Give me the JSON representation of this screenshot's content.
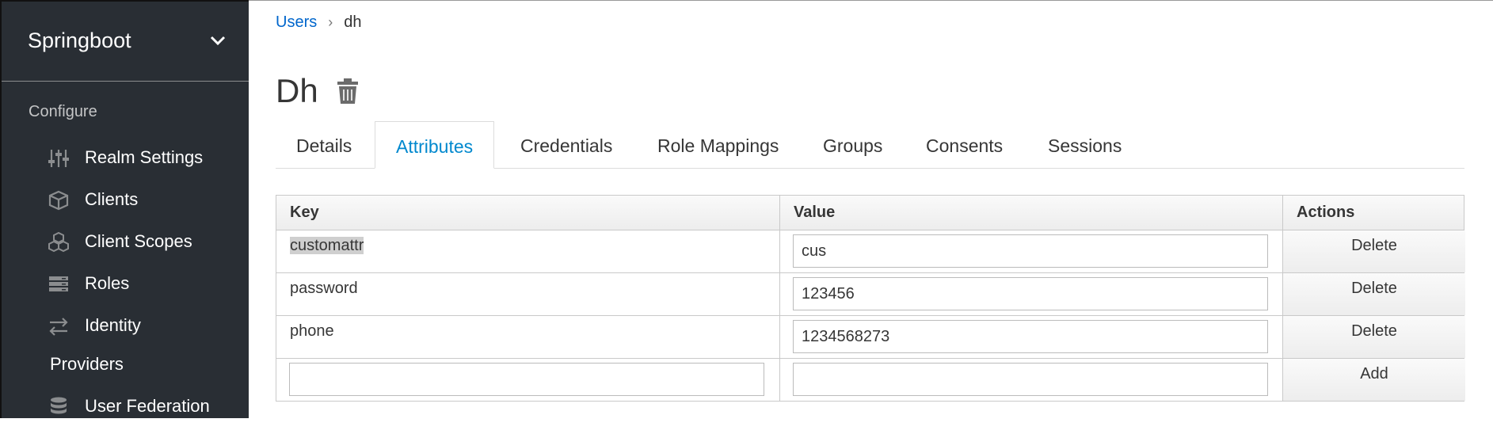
{
  "sidebar": {
    "realm_name": "Springboot",
    "section_label": "Configure",
    "items": [
      {
        "label": "Realm Settings",
        "icon": "sliders-icon"
      },
      {
        "label": "Clients",
        "icon": "cube-icon"
      },
      {
        "label": "Client Scopes",
        "icon": "cubes-icon"
      },
      {
        "label": "Roles",
        "icon": "server-icon"
      },
      {
        "label": "Identity",
        "label_cont": "Providers",
        "icon": "exchange-icon"
      },
      {
        "label": "User Federation",
        "icon": "database-icon"
      }
    ]
  },
  "breadcrumb": {
    "users": "Users",
    "separator": "›",
    "current": "dh"
  },
  "page_title": "Dh",
  "tabs": [
    {
      "label": "Details"
    },
    {
      "label": "Attributes",
      "active": true
    },
    {
      "label": "Credentials"
    },
    {
      "label": "Role Mappings"
    },
    {
      "label": "Groups"
    },
    {
      "label": "Consents"
    },
    {
      "label": "Sessions"
    }
  ],
  "table": {
    "headers": {
      "key": "Key",
      "value": "Value",
      "actions": "Actions"
    },
    "rows": [
      {
        "key": "customattr",
        "value": "cus",
        "action": "Delete"
      },
      {
        "key": "password",
        "value": "123456",
        "action": "Delete"
      },
      {
        "key": "phone",
        "value": "1234568273",
        "action": "Delete"
      }
    ],
    "new_row": {
      "key": "",
      "value": "",
      "action": "Add"
    }
  },
  "colors": {
    "sidebar_bg": "#292e34",
    "link": "#0066cc",
    "active_tab": "#0088ce"
  }
}
